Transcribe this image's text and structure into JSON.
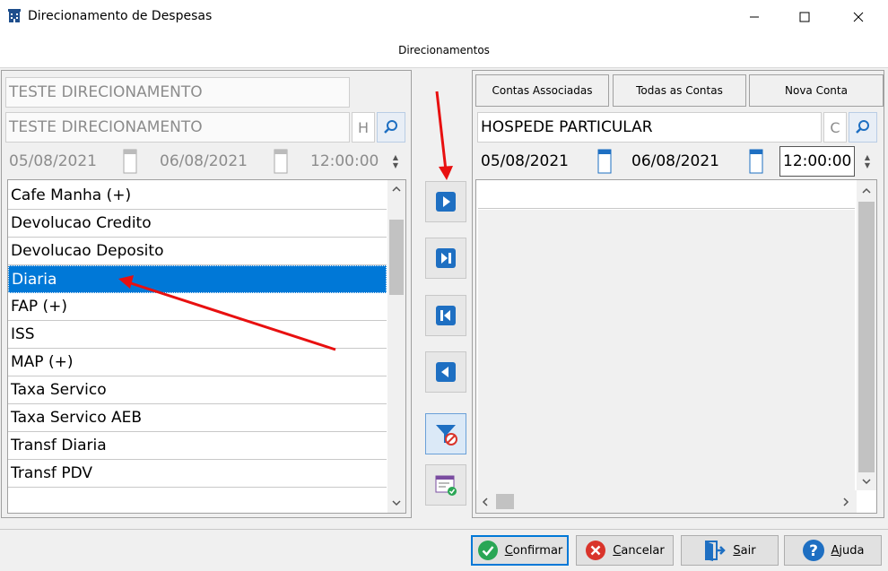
{
  "window": {
    "title": "Direcionamento de Despesas"
  },
  "section_title": "Direcionamentos",
  "left": {
    "name1": "TESTE DIRECIONAMENTO",
    "name2": "TESTE DIRECIONAMENTO",
    "type_letter": "H",
    "date_from": "05/08/2021",
    "date_to": "06/08/2021",
    "time": "12:00:00",
    "items": [
      "Cafe Manha (+)",
      "Devolucao Credito",
      "Devolucao Deposito",
      "Diaria",
      "FAP (+)",
      "ISS",
      "MAP (+)",
      "Taxa Servico",
      "Taxa Servico AEB",
      "Transf Diaria",
      "Transf PDV"
    ],
    "selected_item": "Diaria"
  },
  "right": {
    "tabs": [
      "Contas Associadas",
      "Todas as Contas",
      "Nova Conta"
    ],
    "account": "HOSPEDE PARTICULAR",
    "type_letter": "C",
    "date_from": "05/08/2021",
    "date_to": "06/08/2021",
    "time": "12:00:00"
  },
  "buttons": {
    "confirm": "Confirmar",
    "cancel": "Cancelar",
    "exit": "Sair",
    "help": "Ajuda"
  },
  "colors": {
    "selection": "#0078d7",
    "action_blue": "#1e6fc2",
    "arrow_annotation": "#e81010",
    "confirm_green": "#2aa655",
    "cancel_red": "#d9342b"
  }
}
